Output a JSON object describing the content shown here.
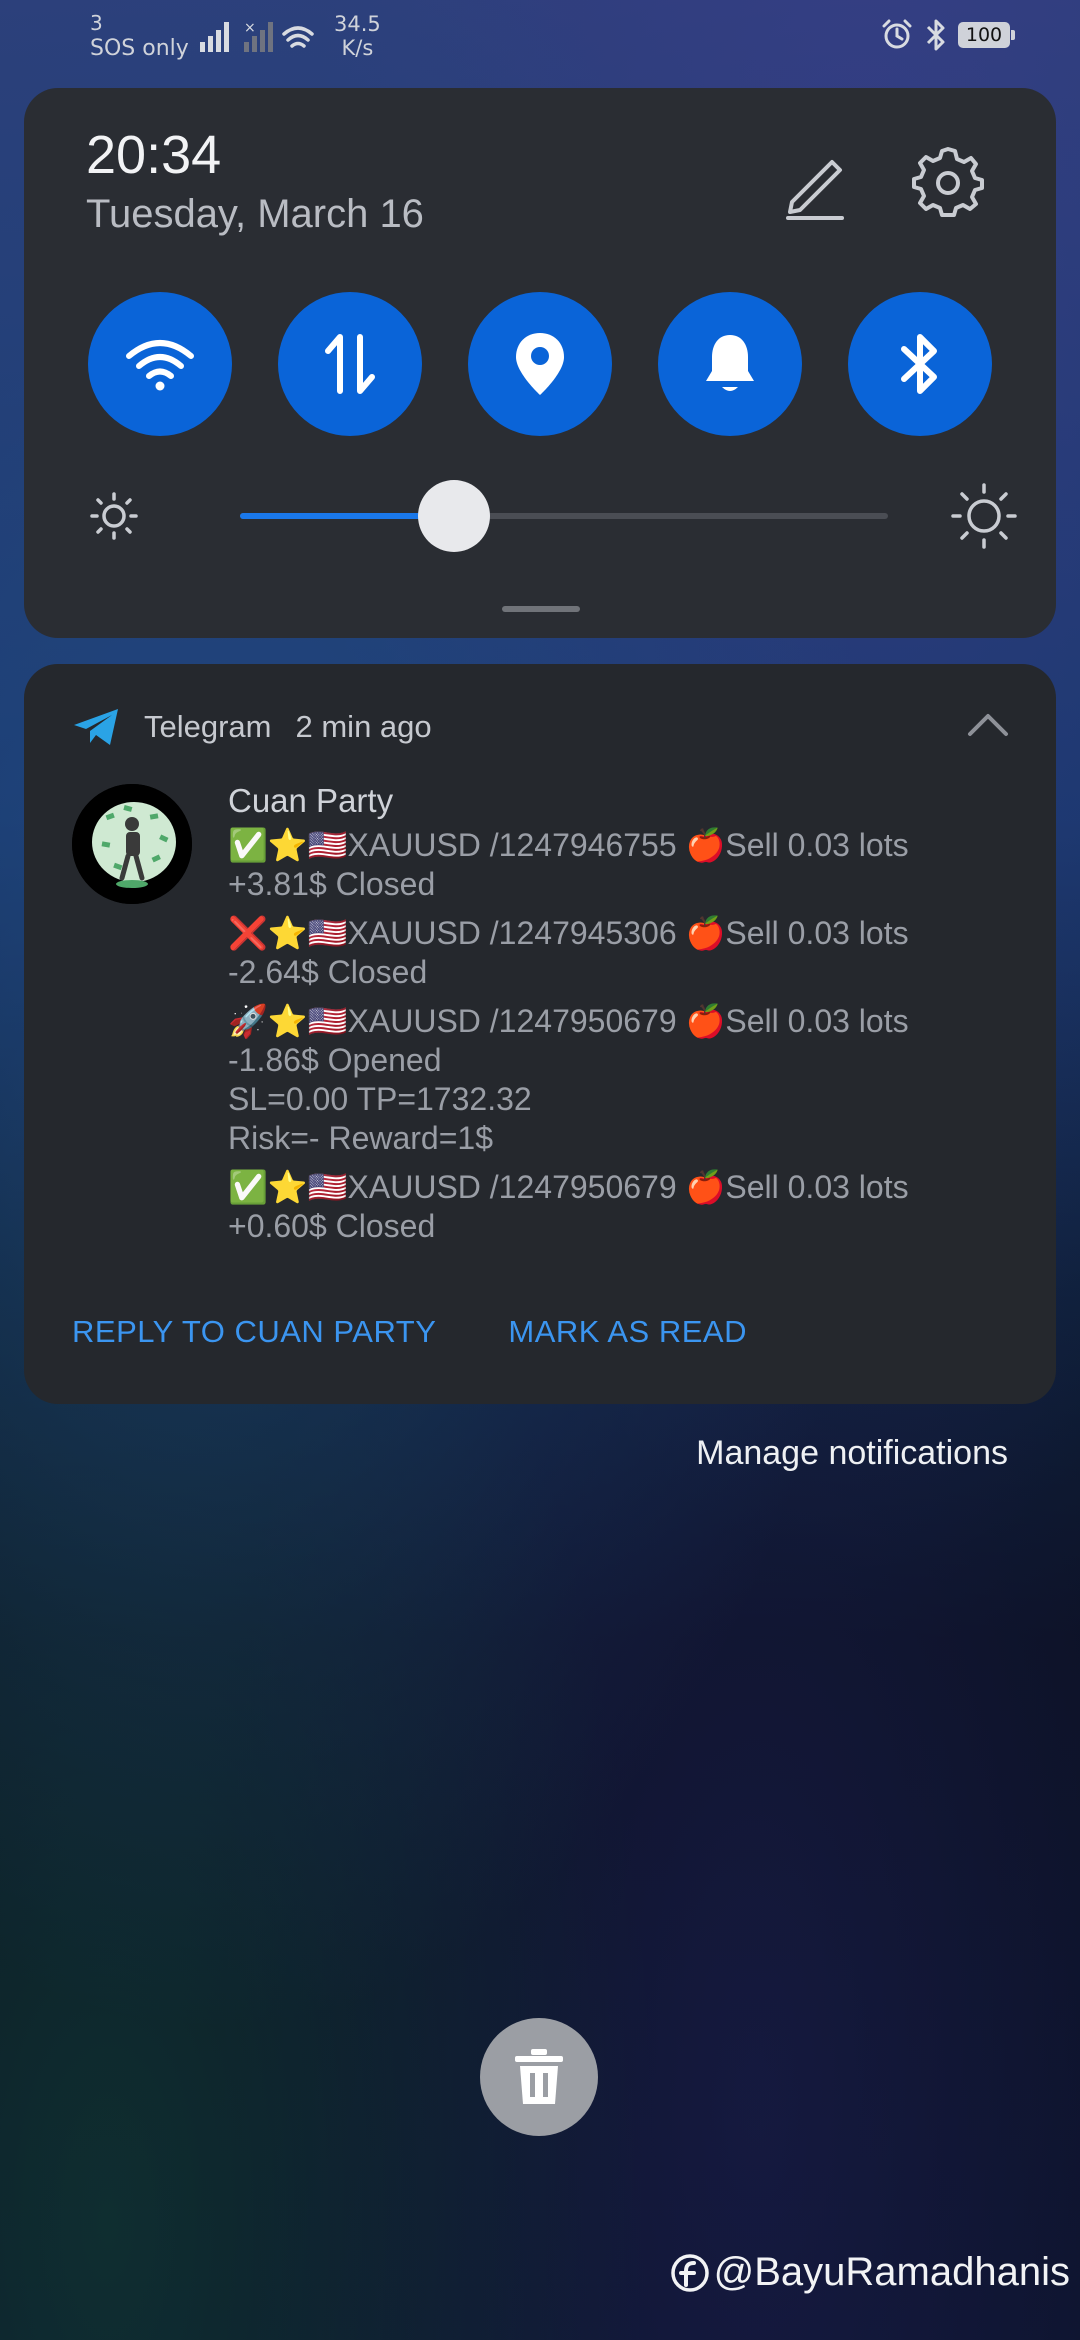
{
  "status_bar": {
    "carrier_line1": "3",
    "carrier_line2": "SOS only",
    "speed_value": "34.5",
    "speed_unit": "K/s",
    "battery": "100",
    "icons": [
      "signal-icon",
      "no-signal-icon",
      "wifi-icon",
      "alarm-icon",
      "bluetooth-icon",
      "battery-icon"
    ]
  },
  "quick_settings": {
    "time": "20:34",
    "date": "Tuesday, March 16",
    "toggles": [
      {
        "name": "wifi",
        "icon": "wifi-icon",
        "on": true
      },
      {
        "name": "mobile-data",
        "icon": "data-transfer-icon",
        "on": true
      },
      {
        "name": "location",
        "icon": "location-pin-icon",
        "on": true
      },
      {
        "name": "sound",
        "icon": "bell-icon",
        "on": true
      },
      {
        "name": "bluetooth",
        "icon": "bluetooth-icon",
        "on": true
      }
    ],
    "brightness_fraction": 0.33,
    "colors": {
      "accent": "#0a64d8",
      "panel": "#2a2d33"
    }
  },
  "notification": {
    "app": "Telegram",
    "time_ago": "2 min ago",
    "sender": "Cuan Party",
    "messages": [
      {
        "line1": "✅⭐🇺🇸XAUUSD /1247946755 🍎Sell 0.03 lots",
        "line2": "+3.81$  Closed"
      },
      {
        "line1": "❌⭐🇺🇸XAUUSD /1247945306 🍎Sell 0.03 lots",
        "line2": "-2.64$  Closed"
      },
      {
        "line1": "🚀⭐🇺🇸XAUUSD /1247950679 🍎Sell 0.03 lots",
        "line2": "-1.86$  Opened",
        "line3": "SL=0.00 TP=1732.32",
        "line4": "Risk=- Reward=1$"
      },
      {
        "line1": "✅⭐🇺🇸XAUUSD /1247950679 🍎Sell 0.03 lots",
        "line2": "+0.60$  Closed"
      }
    ],
    "actions": {
      "reply": "REPLY TO CUAN PARTY",
      "mark_read": "MARK AS READ"
    }
  },
  "manage_notifications": "Manage notifications",
  "watermark": "@BayuRamadhanis"
}
